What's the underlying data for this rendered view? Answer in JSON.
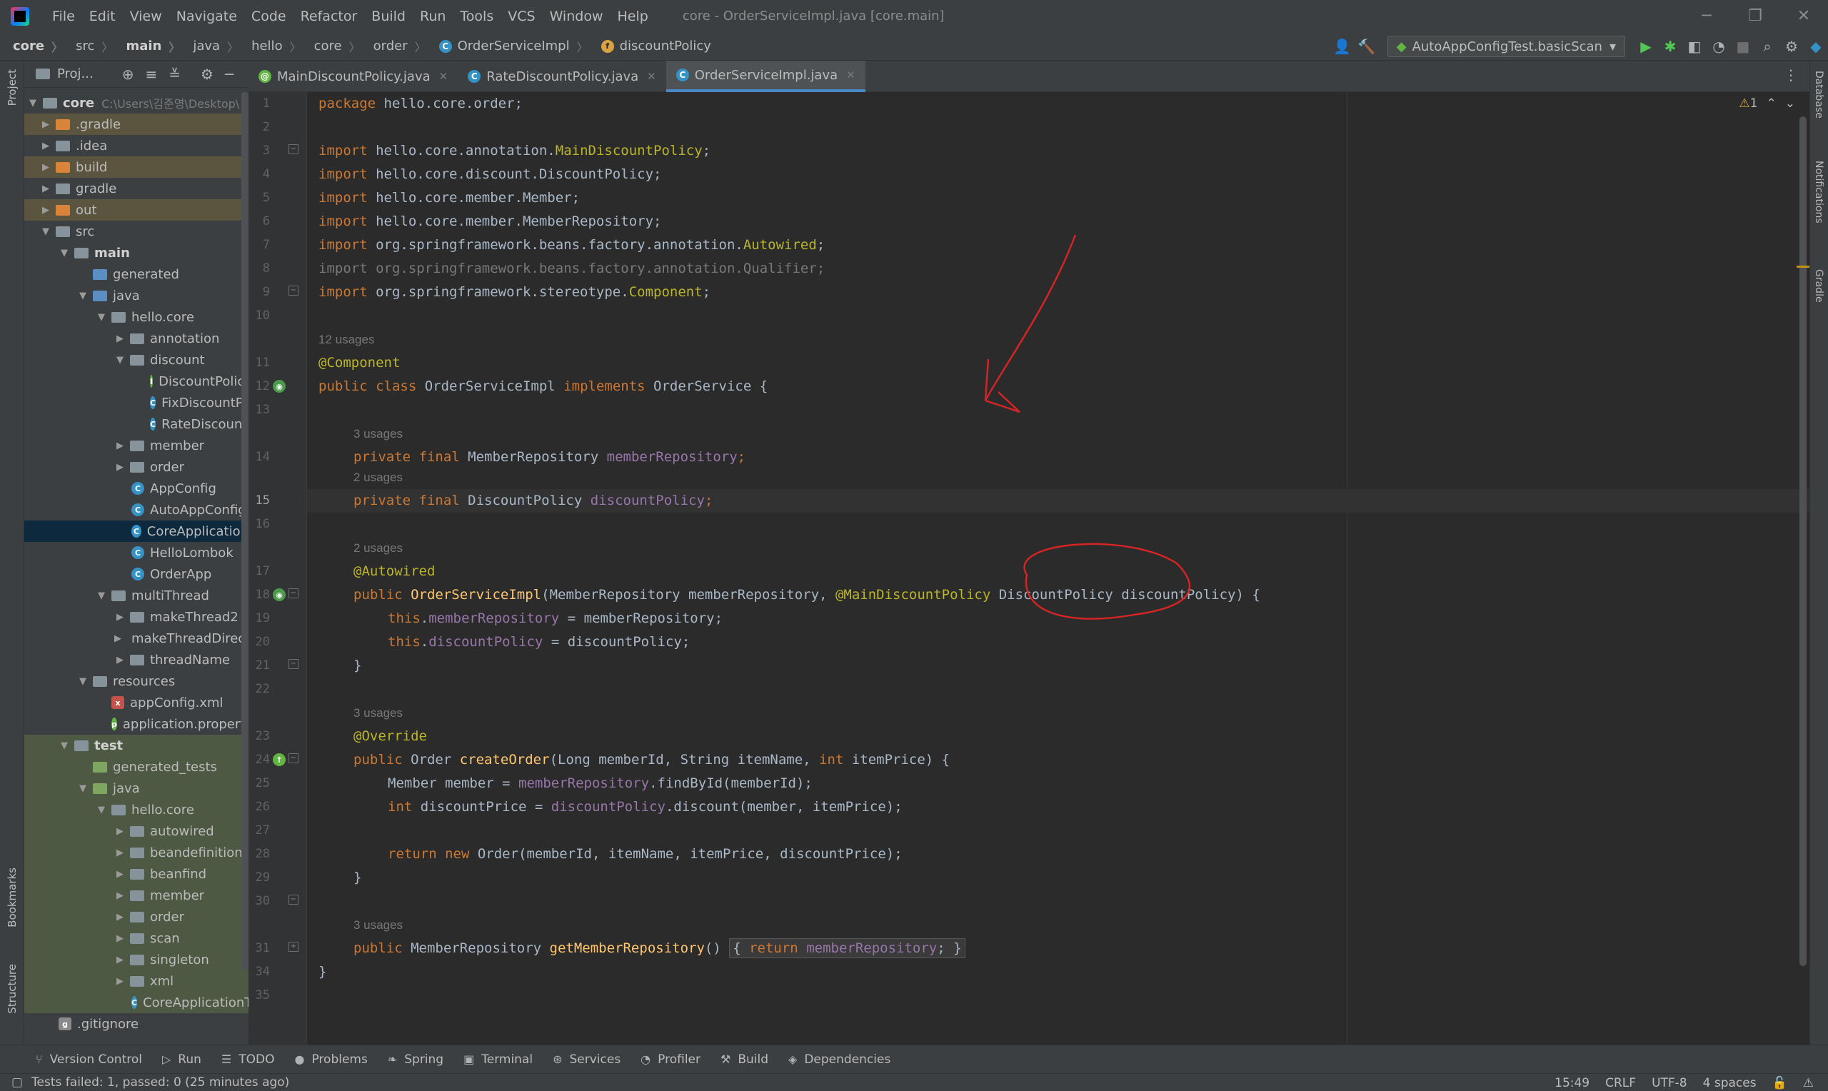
{
  "window": {
    "title": "core - OrderServiceImpl.java [core.main]"
  },
  "menu": [
    "File",
    "Edit",
    "View",
    "Navigate",
    "Code",
    "Refactor",
    "Build",
    "Run",
    "Tools",
    "VCS",
    "Window",
    "Help"
  ],
  "breadcrumb": [
    "core",
    "src",
    "main",
    "java",
    "hello",
    "core",
    "order",
    "OrderServiceImpl",
    "discountPolicy"
  ],
  "run_config": "AutoAppConfigTest.basicScan",
  "project_panel": {
    "title": "Proj...",
    "root_name": "core",
    "root_path": "C:\\Users\\김준영\\Desktop\\",
    "tree": [
      {
        "label": "core",
        "muted": "C:\\Users\\김준영\\Desktop\\"
      },
      {
        "label": ".gradle"
      },
      {
        "label": ".idea"
      },
      {
        "label": "build"
      },
      {
        "label": "gradle"
      },
      {
        "label": "out"
      },
      {
        "label": "src"
      },
      {
        "label": "main"
      },
      {
        "label": "generated"
      },
      {
        "label": "java"
      },
      {
        "label": "hello.core"
      },
      {
        "label": "annotation"
      },
      {
        "label": "discount"
      },
      {
        "label": "DiscountPolicy"
      },
      {
        "label": "FixDiscountPol"
      },
      {
        "label": "RateDiscountP"
      },
      {
        "label": "member"
      },
      {
        "label": "order"
      },
      {
        "label": "AppConfig"
      },
      {
        "label": "AutoAppConfig"
      },
      {
        "label": "CoreApplication"
      },
      {
        "label": "HelloLombok"
      },
      {
        "label": "OrderApp"
      },
      {
        "label": "multiThread"
      },
      {
        "label": "makeThread2"
      },
      {
        "label": "makeThreadDirect"
      },
      {
        "label": "threadName"
      },
      {
        "label": "resources"
      },
      {
        "label": "appConfig.xml"
      },
      {
        "label": "application.properties"
      },
      {
        "label": "test"
      },
      {
        "label": "generated_tests"
      },
      {
        "label": "java"
      },
      {
        "label": "hello.core"
      },
      {
        "label": "autowired"
      },
      {
        "label": "beandefinition"
      },
      {
        "label": "beanfind"
      },
      {
        "label": "member"
      },
      {
        "label": "order"
      },
      {
        "label": "scan"
      },
      {
        "label": "singleton"
      },
      {
        "label": "xml"
      },
      {
        "label": "CoreApplicationTe"
      },
      {
        "label": ".gitignore"
      }
    ]
  },
  "tabs": [
    "MainDiscountPolicy.java",
    "RateDiscountPolicy.java",
    "OrderServiceImpl.java"
  ],
  "inspection": {
    "warnings": "1"
  },
  "code": {
    "l1": [
      "package",
      " hello.core.order;"
    ],
    "l3": [
      "import",
      " hello.core.annotation.",
      "MainDiscountPolicy",
      ";"
    ],
    "l4": [
      "import",
      " hello.core.discount.DiscountPolicy;"
    ],
    "l5": [
      "import",
      " hello.core.member.Member;"
    ],
    "l6": [
      "import",
      " hello.core.member.MemberRepository;"
    ],
    "l7": [
      "import",
      " org.springframework.beans.factory.annotation.",
      "Autowired",
      ";"
    ],
    "l8": "import org.springframework.beans.factory.annotation.Qualifier;",
    "l9": [
      "import",
      " org.springframework.stereotype.",
      "Component",
      ";"
    ],
    "h11": "12 usages",
    "l11": "@Component",
    "l12": [
      "public class",
      " OrderServiceImpl ",
      "implements",
      " OrderService {"
    ],
    "h14": "3 usages",
    "l14": [
      "private final",
      " MemberRepository ",
      "memberRepository",
      ";"
    ],
    "h15": "2 usages",
    "l15": [
      "private final",
      " DiscountPolicy ",
      "discountPolicy",
      ";"
    ],
    "h17": "2 usages",
    "l17": "@Autowired",
    "l18": [
      "public",
      " ",
      "OrderServiceImpl",
      "(MemberRepository memberRepository, ",
      "@MainDiscountPolicy",
      " DiscountPolicy discountPolicy) {"
    ],
    "l19": [
      "this",
      ".",
      "memberRepository",
      " = memberRepository;"
    ],
    "l20": [
      "this",
      ".",
      "discountPolicy",
      " = discountPolicy;"
    ],
    "l21": "}",
    "h23": "3 usages",
    "l23": "@Override",
    "l24": [
      "public",
      " Order ",
      "createOrder",
      "(Long memberId, String itemName, ",
      "int",
      " itemPrice) {"
    ],
    "l25": [
      "Member member = ",
      "memberRepository",
      ".findById(memberId);"
    ],
    "l26": [
      "int",
      " discountPrice = ",
      "discountPolicy",
      ".discount(member, itemPrice);"
    ],
    "l28": [
      "return new",
      " Order(memberId, itemName, itemPrice, discountPrice);"
    ],
    "l29": "}",
    "h31": "3 usages",
    "l31": [
      "public",
      " MemberRepository ",
      "getMemberRepository",
      "() ",
      "{ ",
      "return",
      " ",
      "memberRepository",
      "; }"
    ],
    "l34": "}"
  },
  "line_numbers": [
    "1",
    "2",
    "3",
    "4",
    "5",
    "6",
    "7",
    "8",
    "9",
    "10",
    "11",
    "12",
    "13",
    "14",
    "15",
    "16",
    "17",
    "18",
    "19",
    "20",
    "21",
    "22",
    "23",
    "24",
    "25",
    "26",
    "27",
    "28",
    "29",
    "30",
    "31",
    "34",
    "35"
  ],
  "bottom_tools": [
    "Version Control",
    "Run",
    "TODO",
    "Problems",
    "Spring",
    "Terminal",
    "Services",
    "Profiler",
    "Build",
    "Dependencies"
  ],
  "status": {
    "message": "Tests failed: 1, passed: 0 (25 minutes ago)",
    "position": "15:49",
    "line_sep": "CRLF",
    "encoding": "UTF-8",
    "indent": "4 spaces"
  },
  "side_tools": {
    "left": [
      "Project",
      "Bookmarks",
      "Structure"
    ],
    "right": [
      "Database",
      "Notifications",
      "Gradle"
    ]
  },
  "colors": {
    "keyword": "#cc7832",
    "annotation": "#bbb529",
    "field": "#9876aa",
    "method": "#ffc66d",
    "plain": "#a9b7c6",
    "hint": "#787878",
    "ink_annotation": "#d92424"
  }
}
